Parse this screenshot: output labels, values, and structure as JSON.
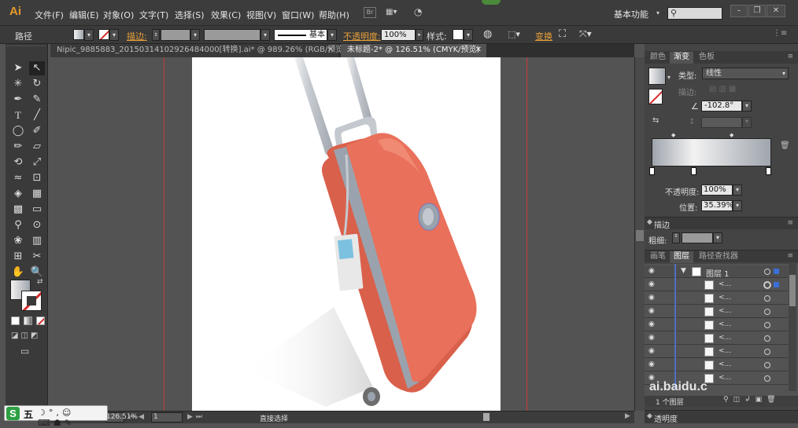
{
  "app": {
    "logo": "Ai"
  },
  "menu": [
    "文件(F)",
    "编辑(E)",
    "对象(O)",
    "文字(T)",
    "选择(S)",
    "效果(C)",
    "视图(V)",
    "窗口(W)",
    "帮助(H)"
  ],
  "menubar_right": {
    "workspace": "基本功能",
    "search_placeholder": "",
    "bridge_label": "Br"
  },
  "control": {
    "selection_type": "路径",
    "stroke_label": "描边:",
    "stroke_style": "基本",
    "opacity_label": "不透明度:",
    "opacity_value": "100%",
    "style_label": "样式:",
    "transform_label": "变换"
  },
  "tabs": [
    {
      "label": "Nipic_9885883_20150314102926484000[转换].ai* @ 989.26% (RGB/预览)",
      "active": false
    },
    {
      "label": "未标题-2* @ 126.51% (CMYK/预览)",
      "active": true
    }
  ],
  "status": {
    "zoom": "126.51%",
    "page": "1",
    "tool": "直接选择"
  },
  "panel_gradient": {
    "tabs": [
      "颜色",
      "渐变",
      "色板"
    ],
    "active_tab": "渐变",
    "type_label": "类型:",
    "type_value": "线性",
    "stroke_label": "描边:",
    "angle_value": "-102.8°",
    "opacity_label": "不透明度:",
    "opacity_value": "100%",
    "position_label": "位置:",
    "position_value": "35.39%",
    "colors": {
      "start": "#f2f2f2",
      "end": "#9fa5ad"
    }
  },
  "panel_stroke": {
    "title": "描边",
    "weight_label": "粗细:"
  },
  "panel_layers": {
    "tabs": [
      "画笔",
      "图层",
      "路径查找器"
    ],
    "active_tab": "图层",
    "layer_name": "图层 1",
    "sublayers": [
      "<...",
      "<...",
      "<...",
      "<...",
      "<...",
      "<...",
      "<...",
      "<..."
    ],
    "footer_count": "1 个图层"
  },
  "panel_transparency": {
    "title": "透明度"
  },
  "watermark": {
    "text": "ai.baidu.c"
  },
  "ime": {
    "label": "五"
  },
  "illustration": {
    "subject": "suitcase",
    "colors": {
      "shell": "#e9705a",
      "shell_light": "#f08a72",
      "rail": "#9aa3ad",
      "handle": "#c4c9cf",
      "tag": "#e8e8e8",
      "tag_screen": "#7cc2e0",
      "wheel": "#6d6d6d"
    }
  }
}
